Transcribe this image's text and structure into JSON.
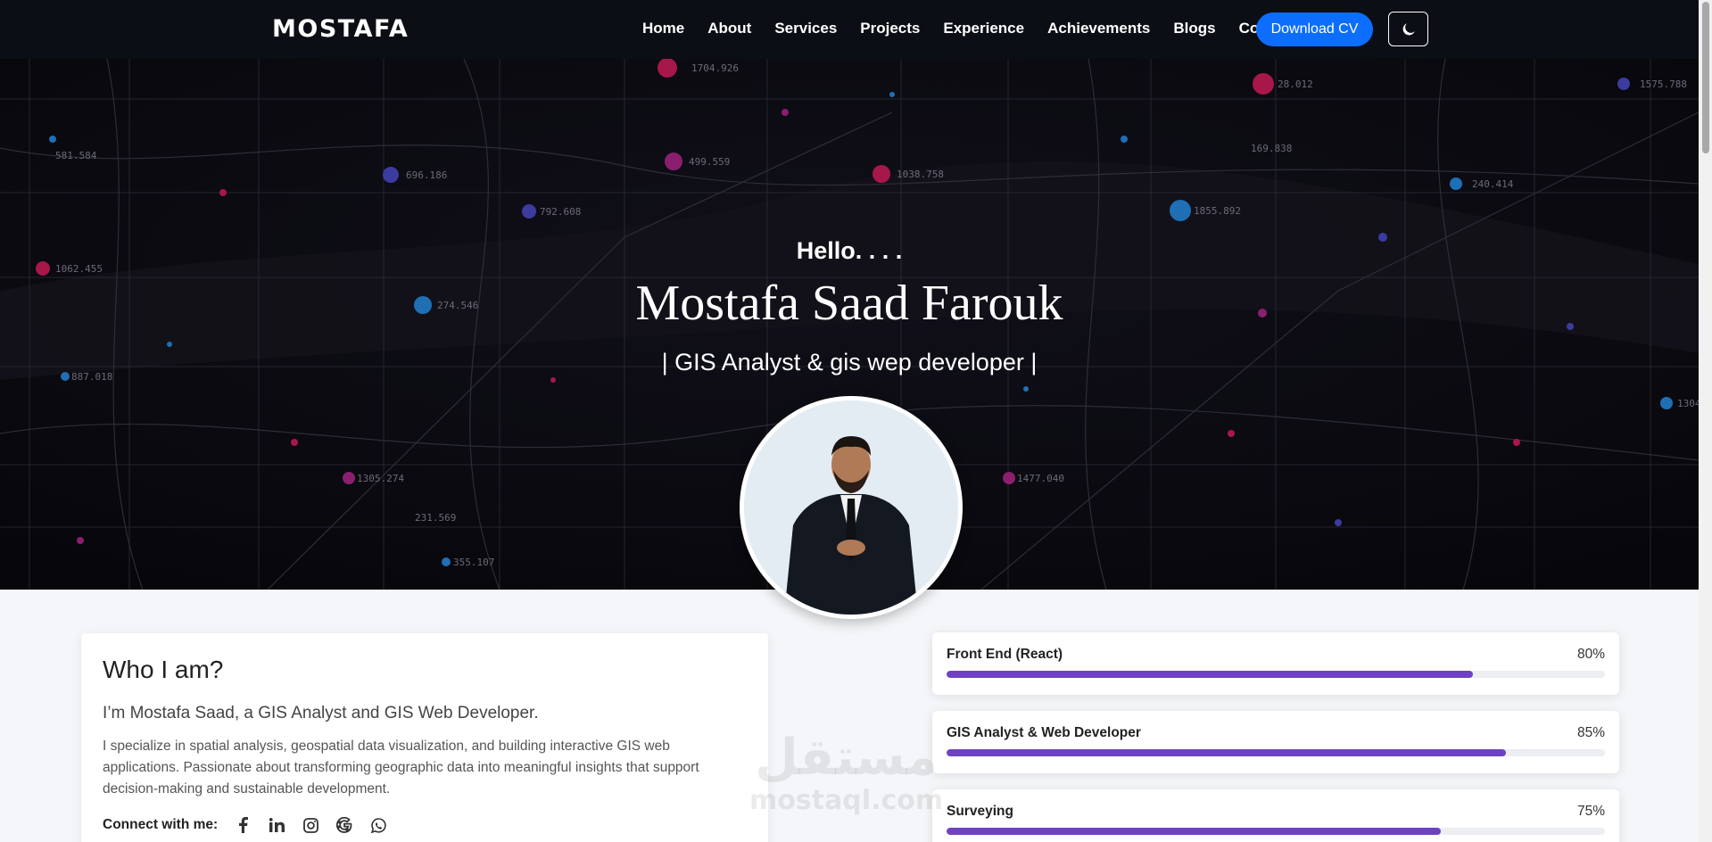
{
  "nav": {
    "brand": "MOSTAFA",
    "links": [
      "Home",
      "About",
      "Services",
      "Projects",
      "Experience",
      "Achievements",
      "Blogs",
      "Contact"
    ],
    "download_cv": "Download CV",
    "theme_icon": "moon-icon"
  },
  "hero": {
    "greeting": "Hello. . . .",
    "name": "Mostafa Saad Farouk",
    "role": "| GIS Analyst & gis wep developer |"
  },
  "about": {
    "title": "Who I am?",
    "intro": "I’m Mostafa Saad, a GIS Analyst and GIS Web Developer.",
    "description": "I specialize in spatial analysis, geospatial data visualization, and building interactive GIS web applications. Passionate about transforming geographic data into meaningful insights that support decision-making and sustainable development.",
    "connect_label": "Connect with me:",
    "socials": [
      "facebook-icon",
      "linkedin-icon",
      "instagram-icon",
      "google-icon",
      "whatsapp-icon"
    ]
  },
  "skills": [
    {
      "name": "Front End (React)",
      "percent_label": "80%",
      "value": 0.8
    },
    {
      "name": "GIS Analyst & Web Developer",
      "percent_label": "85%",
      "value": 0.85
    },
    {
      "name": "Surveying",
      "percent_label": "75%",
      "value": 0.75
    }
  ],
  "watermark": {
    "arabic": "مستقل",
    "latin": "mostaql.com"
  },
  "map_labels": [
    "1704.926",
    "28.012",
    "1575.788",
    "581.584",
    "696.186",
    "499.559",
    "1038.758",
    "169.838",
    "240.414",
    "792.608",
    "1855.892",
    "1062.455",
    "274.546",
    "887.018",
    "1305.274",
    "1477.040",
    "1304",
    "231.569",
    "355.107"
  ],
  "colors": {
    "accent": "#0d6efd",
    "progress": "#6f42c1",
    "nav_bg": "#0b0e14"
  }
}
